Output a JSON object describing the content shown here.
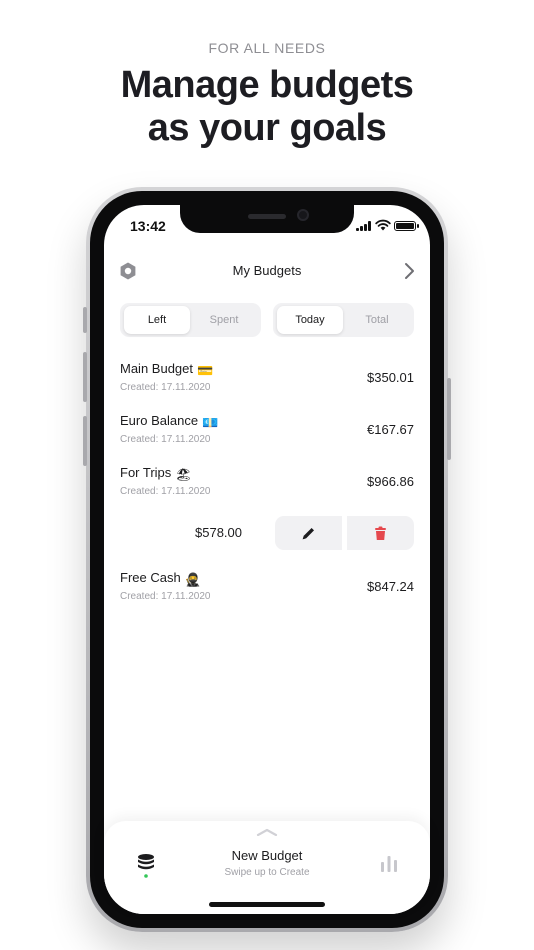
{
  "promo": {
    "eyebrow": "FOR ALL NEEDS",
    "headline_line1": "Manage budgets",
    "headline_line2": "as your goals"
  },
  "status_bar": {
    "time": "13:42"
  },
  "nav": {
    "title": "My Budgets",
    "left_icon": "settings-hexagon-icon",
    "right_icon": "chevron-right-icon"
  },
  "segments": {
    "balance": {
      "options": [
        "Left",
        "Spent"
      ],
      "selected": "Left"
    },
    "period": {
      "options": [
        "Today",
        "Total"
      ],
      "selected": "Today"
    }
  },
  "budgets": [
    {
      "name": "Main Budget",
      "emoji": "💳",
      "created": "Created: 17.11.2020",
      "amount": "$350.01"
    },
    {
      "name": "Euro Balance",
      "emoji": "💶",
      "created": "Created: 17.11.2020",
      "amount": "€167.67"
    },
    {
      "name": "For Trips",
      "emoji": "🏖",
      "created": "Created: 17.11.2020",
      "amount": "$966.86"
    },
    {
      "name": "Free Cash",
      "emoji": "🥷",
      "created": "Created: 17.11.2020",
      "amount": "$847.24"
    }
  ],
  "swiped_row": {
    "amount": "$578.00",
    "actions": [
      "pencil-icon",
      "trash-icon"
    ],
    "delete_color": "#e5484d"
  },
  "bottom_sheet": {
    "title": "New Budget",
    "subtitle": "Swipe up to Create",
    "left_icon": "stack-icon",
    "right_icon": "bar-chart-icon",
    "indicator_color": "#34c759"
  }
}
